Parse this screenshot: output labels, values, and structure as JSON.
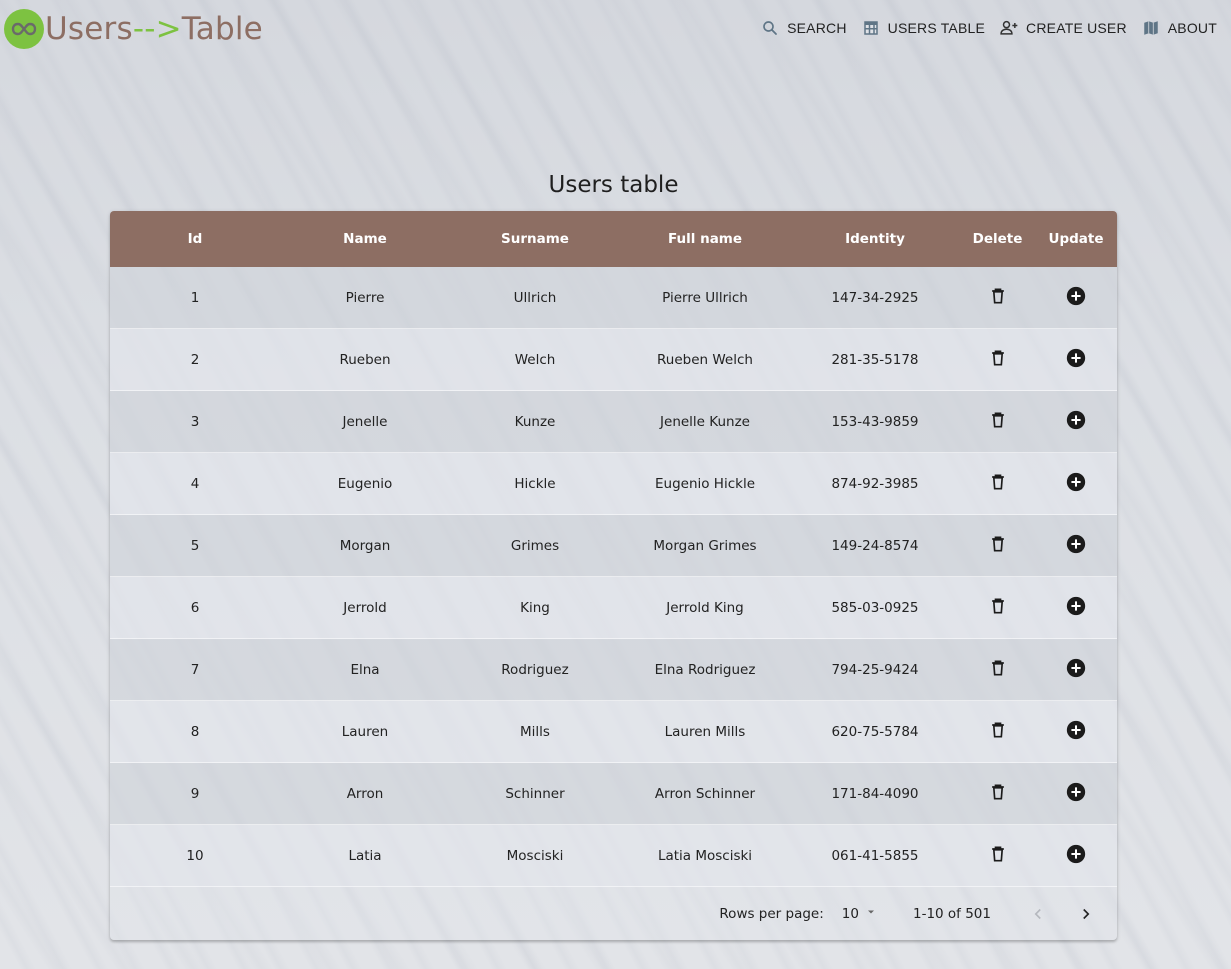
{
  "header": {
    "brand_prefix": "Users",
    "brand_arrow": "-->",
    "brand_suffix": "Table",
    "nav": [
      {
        "label": "SEARCH",
        "icon": "search-icon"
      },
      {
        "label": "USERS TABLE",
        "icon": "table-icon"
      },
      {
        "label": "CREATE USER",
        "icon": "person-add-icon"
      },
      {
        "label": "ABOUT",
        "icon": "map-icon"
      }
    ]
  },
  "main": {
    "title": "Users table",
    "columns": [
      "Id",
      "Name",
      "Surname",
      "Full name",
      "Identity",
      "Delete",
      "Update"
    ],
    "rows": [
      {
        "id": "1",
        "name": "Pierre",
        "surname": "Ullrich",
        "full_name": "Pierre Ullrich",
        "identity": "147-34-2925"
      },
      {
        "id": "2",
        "name": "Rueben",
        "surname": "Welch",
        "full_name": "Rueben Welch",
        "identity": "281-35-5178"
      },
      {
        "id": "3",
        "name": "Jenelle",
        "surname": "Kunze",
        "full_name": "Jenelle Kunze",
        "identity": "153-43-9859"
      },
      {
        "id": "4",
        "name": "Eugenio",
        "surname": "Hickle",
        "full_name": "Eugenio Hickle",
        "identity": "874-92-3985"
      },
      {
        "id": "5",
        "name": "Morgan",
        "surname": "Grimes",
        "full_name": "Morgan Grimes",
        "identity": "149-24-8574"
      },
      {
        "id": "6",
        "name": "Jerrold",
        "surname": "King",
        "full_name": "Jerrold King",
        "identity": "585-03-0925"
      },
      {
        "id": "7",
        "name": "Elna",
        "surname": "Rodriguez",
        "full_name": "Elna Rodriguez",
        "identity": "794-25-9424"
      },
      {
        "id": "8",
        "name": "Lauren",
        "surname": "Mills",
        "full_name": "Lauren Mills",
        "identity": "620-75-5784"
      },
      {
        "id": "9",
        "name": "Arron",
        "surname": "Schinner",
        "full_name": "Arron Schinner",
        "identity": "171-84-4090"
      },
      {
        "id": "10",
        "name": "Latia",
        "surname": "Mosciski",
        "full_name": "Latia Mosciski",
        "identity": "061-41-5855"
      }
    ],
    "pagination": {
      "rows_per_page_label": "Rows per page:",
      "rows_per_page_value": "10",
      "range": "1-10 of 501"
    }
  },
  "colors": {
    "header_brown": "#8d6e63",
    "brand_green": "#7dc241"
  }
}
